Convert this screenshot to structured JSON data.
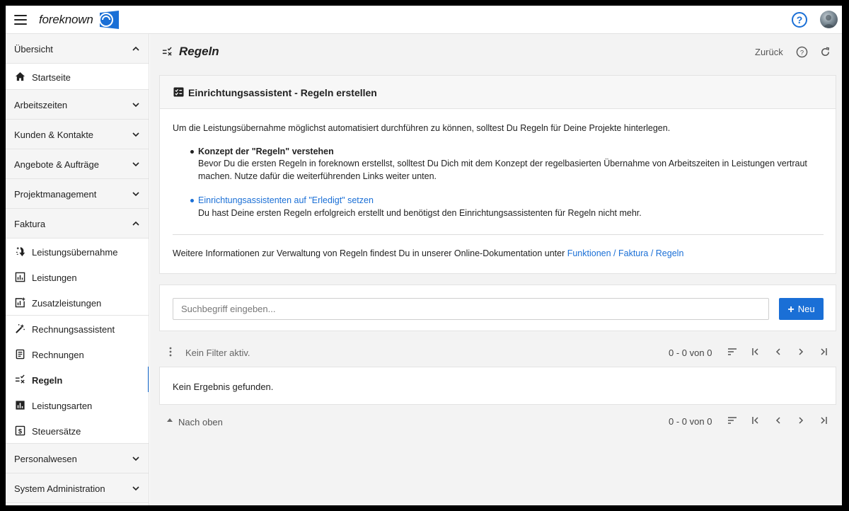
{
  "topbar": {
    "logo_text": "foreknown",
    "brand_color": "#1a6fd6"
  },
  "sidebar": {
    "sections": [
      {
        "label": "Übersicht",
        "expanded": true
      },
      {
        "label": "Arbeitszeiten",
        "expanded": false
      },
      {
        "label": "Kunden & Kontakte",
        "expanded": false
      },
      {
        "label": "Angebote & Aufträge",
        "expanded": false
      },
      {
        "label": "Projektmanagement",
        "expanded": false
      },
      {
        "label": "Faktura",
        "expanded": true
      },
      {
        "label": "Personalwesen",
        "expanded": false
      },
      {
        "label": "System Administration",
        "expanded": false
      }
    ],
    "overview_items": [
      {
        "label": "Startseite",
        "icon": "home-icon"
      }
    ],
    "faktura_items": [
      {
        "label": "Leistungsübernahme",
        "icon": "transfer-icon"
      },
      {
        "label": "Leistungen",
        "icon": "report-icon"
      },
      {
        "label": "Zusatzleistungen",
        "icon": "report-add-icon"
      },
      {
        "label": "Rechnungsassistent",
        "icon": "magic-wand-icon"
      },
      {
        "label": "Rechnungen",
        "icon": "receipt-icon"
      },
      {
        "label": "Regeln",
        "icon": "rule-icon",
        "active": true
      },
      {
        "label": "Leistungsarten",
        "icon": "chart-icon"
      },
      {
        "label": "Steuersätze",
        "icon": "dollar-icon"
      }
    ]
  },
  "page": {
    "title": "Regeln",
    "back_label": "Zurück"
  },
  "wizard": {
    "title": "Einrichtungsassistent - Regeln erstellen",
    "intro": "Um die Leistungsübernahme möglichst automatisiert durchführen zu können, solltest Du Regeln für Deine Projekte hinterlegen.",
    "step1_title": "Konzept der \"Regeln\" verstehen",
    "step1_line1": "Bevor Du die ersten Regeln in foreknown erstellst, solltest Du Dich mit dem Konzept der regelbasierten Übernahme von Arbeitszeiten in Leistungen vertraut",
    "step1_line2": "machen. Nutze dafür die weiterführenden Links weiter unten.",
    "step2_link": "Einrichtungsassistenten auf \"Erledigt\" setzen",
    "step2_text": "Du hast Deine ersten Regeln erfolgreich erstellt und benötigst den Einrichtungsassistenten für Regeln nicht mehr.",
    "more_info_text": "Weitere Informationen zur Verwaltung von Regeln findest Du in unserer Online-Dokumentation unter ",
    "more_info_link": "Funktionen / Faktura / Regeln"
  },
  "search": {
    "placeholder": "Suchbegriff eingeben...",
    "value": "",
    "new_label": "Neu"
  },
  "filter_bar": {
    "filter_text": "Kein Filter aktiv.",
    "range_text": "0 - 0 von 0"
  },
  "result": {
    "text": "Kein Ergebnis gefunden."
  },
  "bottom_bar": {
    "top_label": "Nach oben",
    "range_text": "0 - 0 von 0"
  }
}
